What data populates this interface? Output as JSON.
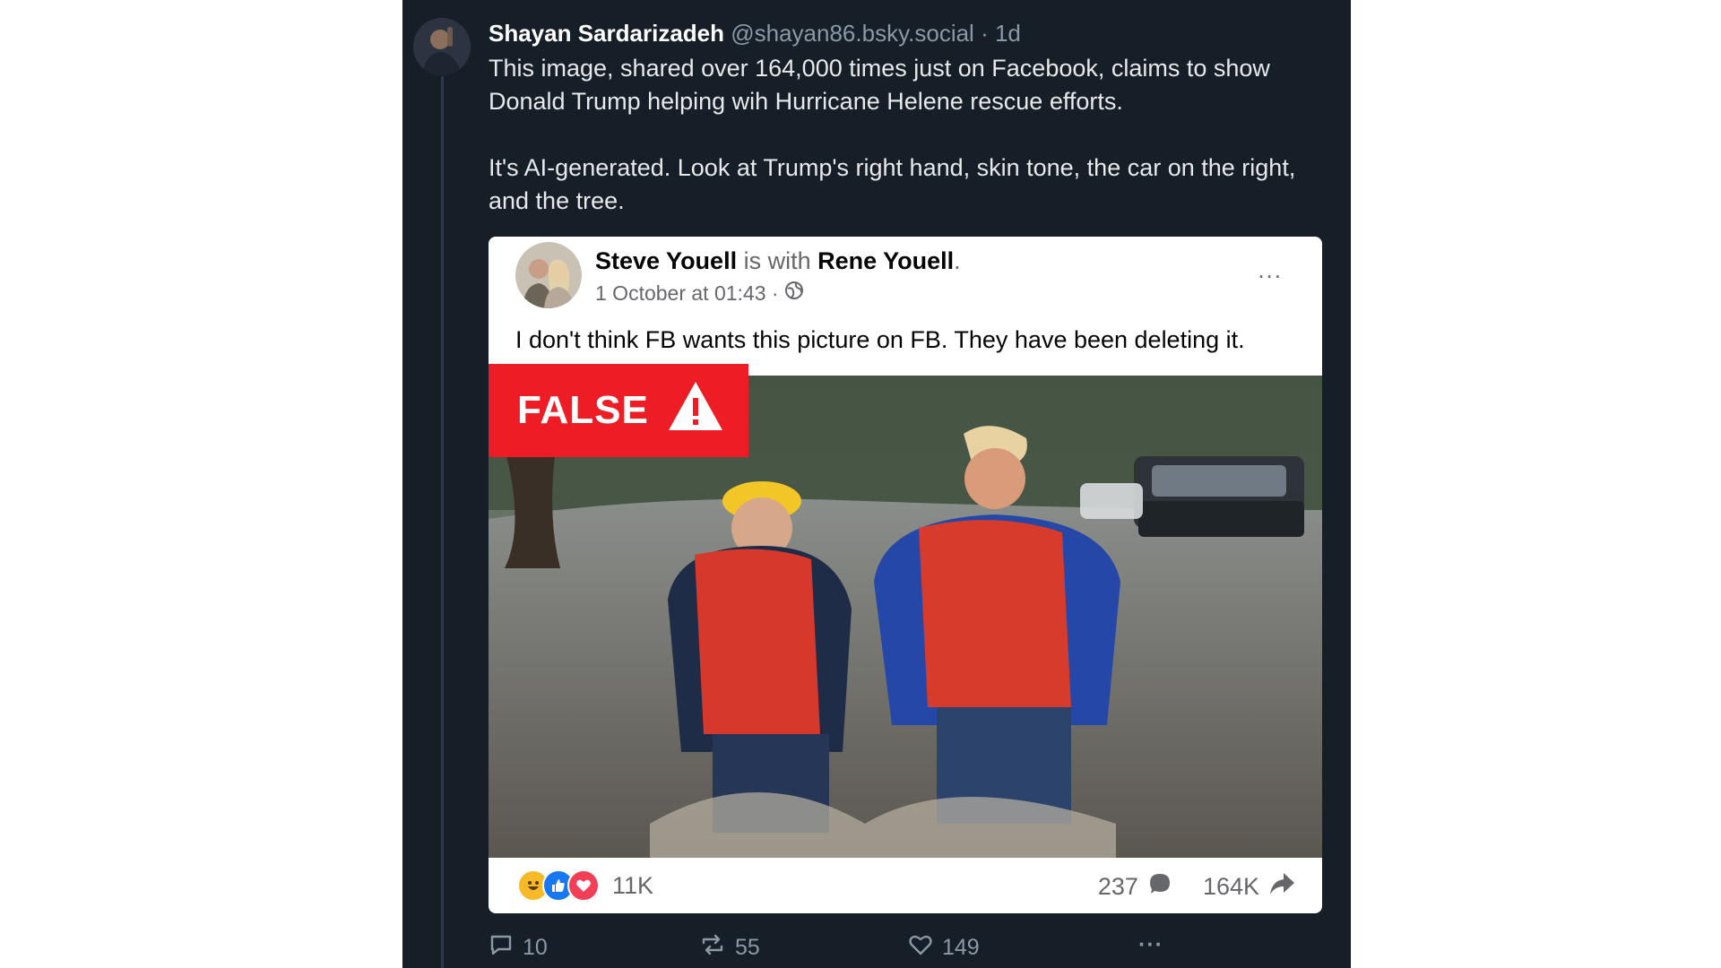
{
  "post": {
    "author_name": "Shayan Sardarizadeh",
    "handle": "@shayan86.bsky.social",
    "time": "· 1d",
    "paragraphs": [
      "This image, shared over 164,000 times just on Facebook, claims to show Donald Trump helping wih Hurricane Helene rescue efforts.",
      "It's AI-generated. Look at Trump's right hand, skin tone, the car on the right, and the tree."
    ]
  },
  "embed": {
    "author": "Steve Youell",
    "with_text": "is with",
    "tagged": "Rene Youell",
    "period": ".",
    "date": "1 October at 01:43 ·",
    "more_icon": "...",
    "text": "I don't think FB wants this picture on FB. They have been deleting it.",
    "badge_label": "FALSE",
    "reaction_icons": [
      "haha-icon",
      "like-icon",
      "love-icon"
    ],
    "reaction_count": "11K",
    "comment_count": "237",
    "share_count": "164K",
    "badge_color": "#ee1c25"
  },
  "actions": {
    "replies": "10",
    "reposts": "55",
    "likes": "149",
    "more": "···"
  },
  "colors": {
    "background": "#161e27",
    "muted_text": "#8b98a5",
    "body_text": "#e7e9ea"
  }
}
